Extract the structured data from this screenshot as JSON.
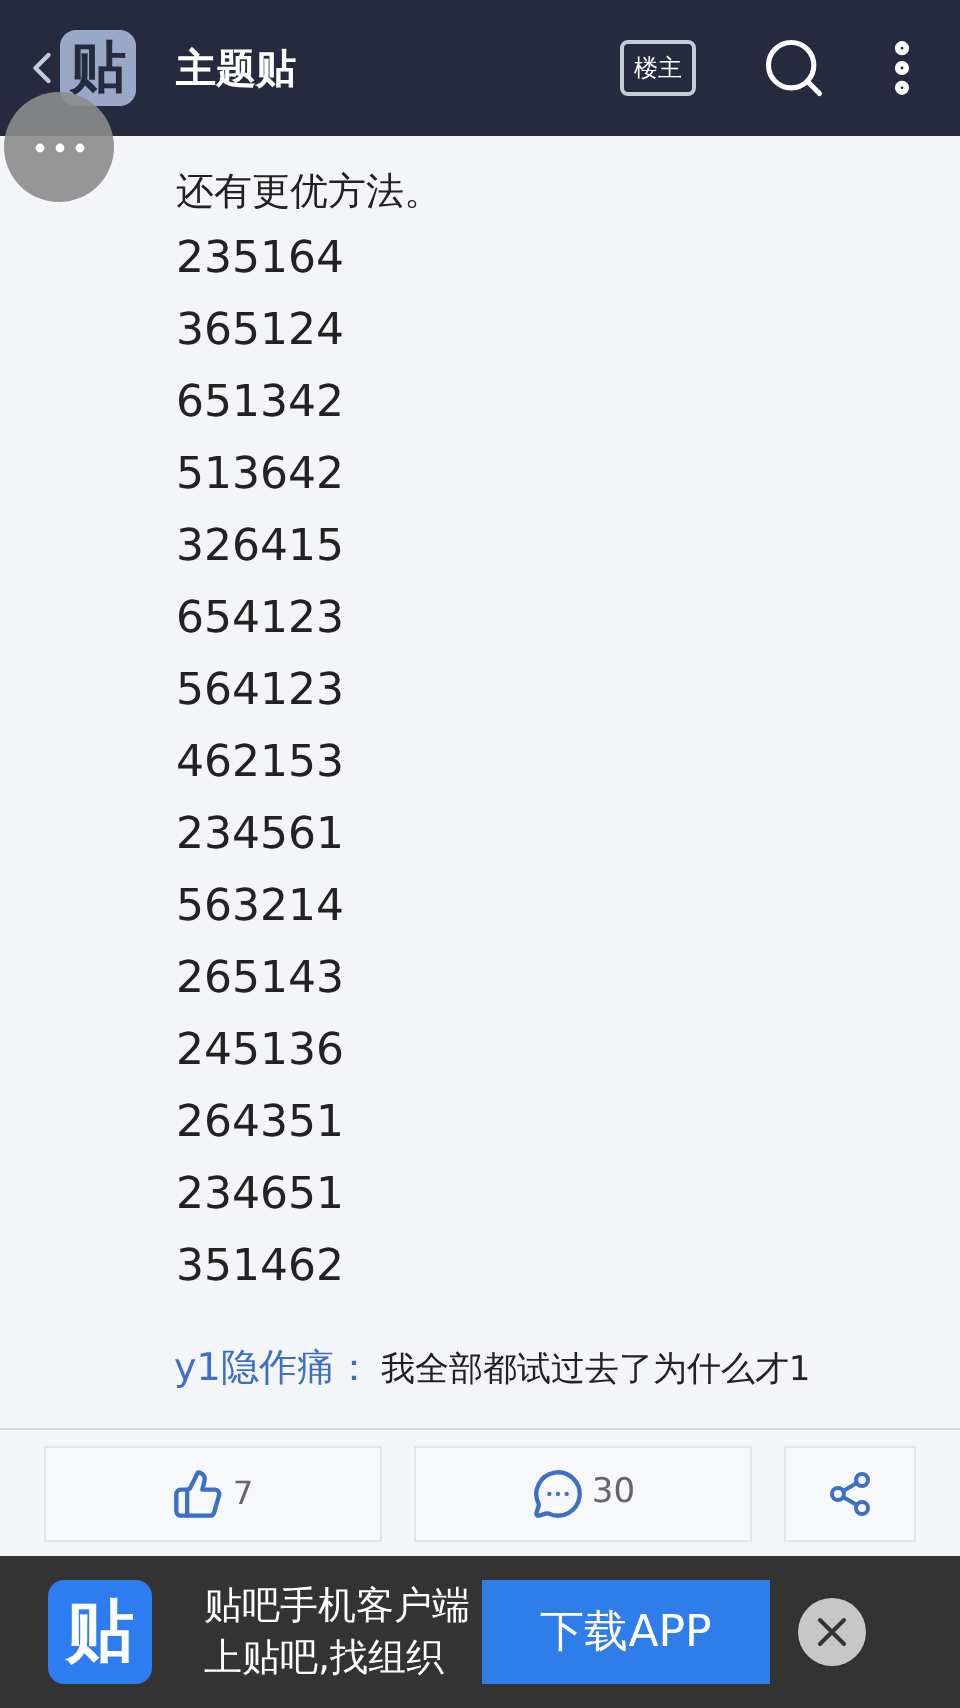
{
  "header": {
    "logo": "贴",
    "title": "主题贴",
    "author_button": "楼主"
  },
  "post": {
    "text": "还有更优方法。",
    "lines": [
      "235164",
      "365124",
      "651342",
      "513642",
      "326415",
      "654123",
      "564123",
      "462153",
      "234561",
      "563214",
      "265143",
      "245136",
      "264351",
      "234651",
      "351462"
    ]
  },
  "reply": {
    "user": "y1隐作痛：",
    "text": "我全部都试过去了为什么才1"
  },
  "actions": {
    "likes": "7",
    "comments": "30"
  },
  "banner": {
    "logo": "贴",
    "line1": "贴吧手机客户端",
    "line2": "上贴吧,找组织",
    "button": "下载APP"
  }
}
